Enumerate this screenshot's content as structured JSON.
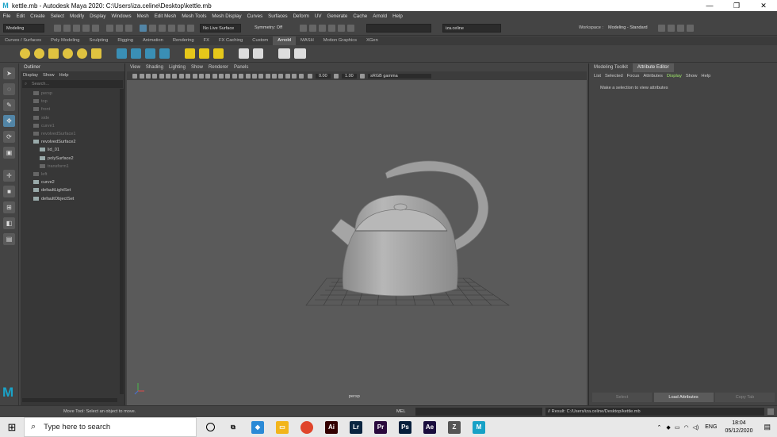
{
  "window": {
    "title": "kettle.mb - Autodesk Maya 2020: C:\\Users\\iza.celine\\Desktop\\kettle.mb",
    "min_glyph": "—",
    "max_glyph": "❐",
    "close_glyph": "✕"
  },
  "menubar": [
    "File",
    "Edit",
    "Create",
    "Select",
    "Modify",
    "Display",
    "Windows",
    "Mesh",
    "Edit Mesh",
    "Mesh Tools",
    "Mesh Display",
    "Curves",
    "Surfaces",
    "Deform",
    "UV",
    "Generate",
    "Cache",
    "Arnold",
    "Help"
  ],
  "statusline": {
    "menuset": "Modeling",
    "live_surface": "No Live Surface",
    "symmetry": "Symmetry: Off",
    "user": "iza.celine",
    "workspace_label": "Workspace :",
    "workspace": "Modeling - Standard"
  },
  "shelf": {
    "tabs": [
      "Curves / Surfaces",
      "Poly Modeling",
      "Sculpting",
      "Rigging",
      "Animation",
      "Rendering",
      "FX",
      "FX Caching",
      "Custom",
      "Arnold",
      "MASH",
      "Motion Graphics",
      "XGen"
    ],
    "active_tab": "Arnold"
  },
  "outliner": {
    "title": "Outliner",
    "menu": [
      "Display",
      "Show",
      "Help"
    ],
    "search_placeholder": "Search...",
    "items": [
      {
        "label": "persp",
        "dim": true,
        "indent": 0
      },
      {
        "label": "top",
        "dim": true,
        "indent": 0
      },
      {
        "label": "front",
        "dim": true,
        "indent": 0
      },
      {
        "label": "side",
        "dim": true,
        "indent": 0
      },
      {
        "label": "curve1",
        "dim": true,
        "indent": 0
      },
      {
        "label": "revolvedSurface1",
        "dim": true,
        "indent": 0
      },
      {
        "label": "revolvedSurface2",
        "dim": false,
        "indent": 0
      },
      {
        "label": "lid_01",
        "dim": false,
        "indent": 1
      },
      {
        "label": "polySurface2",
        "dim": false,
        "indent": 1
      },
      {
        "label": "transform1",
        "dim": true,
        "indent": 1
      },
      {
        "label": "left",
        "dim": true,
        "indent": 0
      },
      {
        "label": "curve2",
        "dim": false,
        "indent": 0
      },
      {
        "label": "defaultLightSet",
        "dim": false,
        "indent": 0
      },
      {
        "label": "defaultObjectSet",
        "dim": false,
        "indent": 0
      }
    ]
  },
  "viewport": {
    "menu": [
      "View",
      "Shading",
      "Lighting",
      "Show",
      "Renderer",
      "Panels"
    ],
    "exposure": "0.00",
    "gamma": "1.00",
    "colorspace": "sRGB gamma",
    "camera": "persp"
  },
  "attribute_editor": {
    "tabs": [
      "Modeling Toolkit",
      "Attribute Editor"
    ],
    "active_tab": "Attribute Editor",
    "menu": [
      "List",
      "Selected",
      "Focus",
      "Attributes",
      "Display",
      "Show",
      "Help"
    ],
    "highlight_menu": "Display",
    "hint": "Make a selection to view attributes",
    "buttons": [
      "Select",
      "Load Attributes",
      "Copy Tab"
    ]
  },
  "helpline": {
    "tool_help": "Move Tool: Select an object to move.",
    "mel_label": "MEL",
    "result": "// Result: C:/Users/iza.celine/Desktop/kettle.mb"
  },
  "taskbar": {
    "search_placeholder": "Type here to search",
    "apps": [
      {
        "name": "chrome",
        "label": "",
        "color": "#e0452b"
      },
      {
        "name": "illustrator",
        "label": "Ai",
        "color": "#330000"
      },
      {
        "name": "lightroom",
        "label": "Lr",
        "color": "#0a2540"
      },
      {
        "name": "premiere",
        "label": "Pr",
        "color": "#2a0a3d"
      },
      {
        "name": "photoshop",
        "label": "Ps",
        "color": "#061e3a"
      },
      {
        "name": "after-effects",
        "label": "Ae",
        "color": "#1a0d3d"
      },
      {
        "name": "zbrush",
        "label": "Z",
        "color": "#555555"
      },
      {
        "name": "maya",
        "label": "M",
        "color": "#17a1c6"
      }
    ],
    "language": "ENG",
    "time": "18:04",
    "date": "05/12/2020"
  }
}
